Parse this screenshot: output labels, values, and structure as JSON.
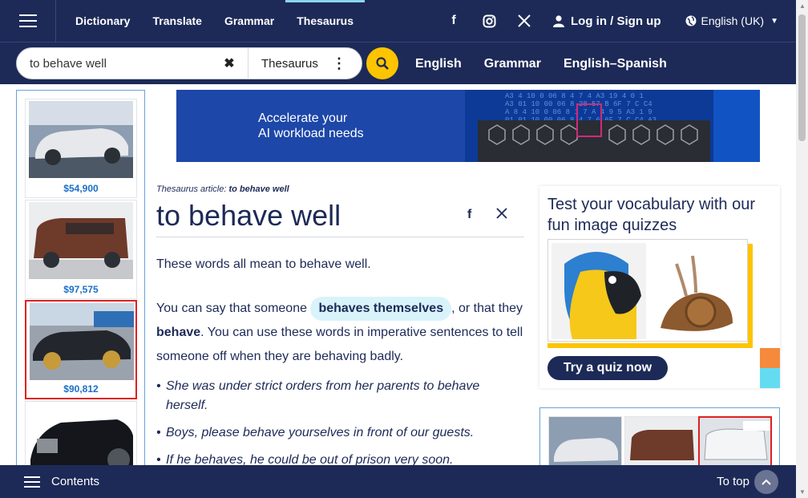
{
  "nav": {
    "items": [
      {
        "label": "Dictionary",
        "active": false
      },
      {
        "label": "Translate",
        "active": false
      },
      {
        "label": "Grammar",
        "active": false
      },
      {
        "label": "Thesaurus",
        "active": true
      }
    ],
    "social": [
      "facebook-icon",
      "instagram-icon",
      "x-icon"
    ],
    "login_label": "Log in / Sign up",
    "language": "English (UK)"
  },
  "search": {
    "value": "to behave well",
    "dictionary": "Thesaurus",
    "quick_links": [
      "English",
      "Grammar",
      "English–Spanish"
    ]
  },
  "left_ads": {
    "prices": [
      "$54,900",
      "$97,575",
      "$90,812"
    ]
  },
  "ad_banner": {
    "line1": "Accelerate your",
    "line2": "AI workload needs"
  },
  "article": {
    "kicker_label": "Thesaurus article:",
    "kicker_term": "to behave well",
    "title": "to behave well",
    "intro": "These words all mean to behave well.",
    "p2_before": "You can say that someone",
    "p2_chip": "behaves themselves",
    "p2_mid": ", or that they",
    "p2_bold": "behave",
    "p2_after": ". You can use these words in imperative sentences to tell someone off when they are behaving badly.",
    "examples": [
      "She was under strict orders from her parents to behave herself.",
      "Boys, please behave yourselves in front of our guests.",
      "If he behaves, he could be out of prison very soon."
    ]
  },
  "quiz": {
    "title": "Test your vocabulary with our fun image quizzes",
    "button": "Try a quiz now"
  },
  "bottom": {
    "contents_label": "Contents",
    "totop_label": "To top"
  },
  "colors": {
    "navy": "#1d2a57",
    "accent_yellow": "#fec400",
    "price_blue": "#1a6fc7",
    "chip_bg": "#d9f3fa"
  }
}
